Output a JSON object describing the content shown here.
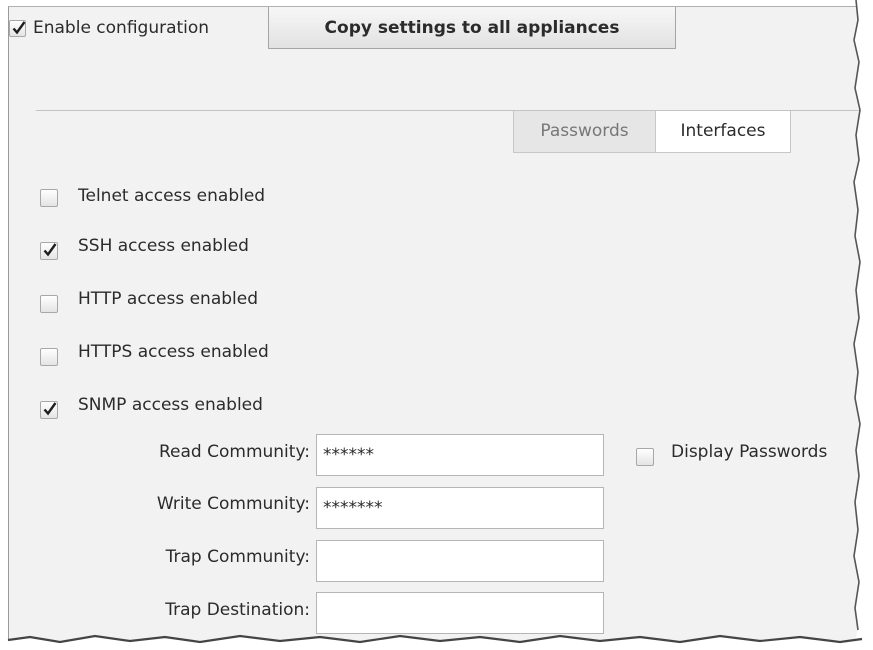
{
  "header": {
    "enable_config_label": "Enable configuration",
    "enable_config_checked": true,
    "copy_button_label": "Copy settings to all appliances"
  },
  "tabs": [
    {
      "label": "Passwords",
      "active": false
    },
    {
      "label": "Interfaces",
      "active": true
    }
  ],
  "access_options": [
    {
      "label": "Telnet access enabled",
      "checked": false
    },
    {
      "label": "SSH access enabled",
      "checked": true
    },
    {
      "label": "HTTP access enabled",
      "checked": false
    },
    {
      "label": "HTTPS access enabled",
      "checked": false
    },
    {
      "label": "SNMP access enabled",
      "checked": true
    }
  ],
  "snmp": {
    "read_community_label": "Read Community:",
    "read_community_value": "******",
    "write_community_label": "Write Community:",
    "write_community_value": "*******",
    "trap_community_label": "Trap Community:",
    "trap_community_value": "",
    "trap_destination_label": "Trap Destination:",
    "trap_destination_value": "",
    "display_passwords_label": "Display Passwords",
    "display_passwords_checked": false
  },
  "colors": {
    "panel_bg": "#f2f2f2",
    "checkmark": "#1e1e1e",
    "inactive_tab": "#e6e6e6",
    "active_tab": "#ffffff"
  }
}
